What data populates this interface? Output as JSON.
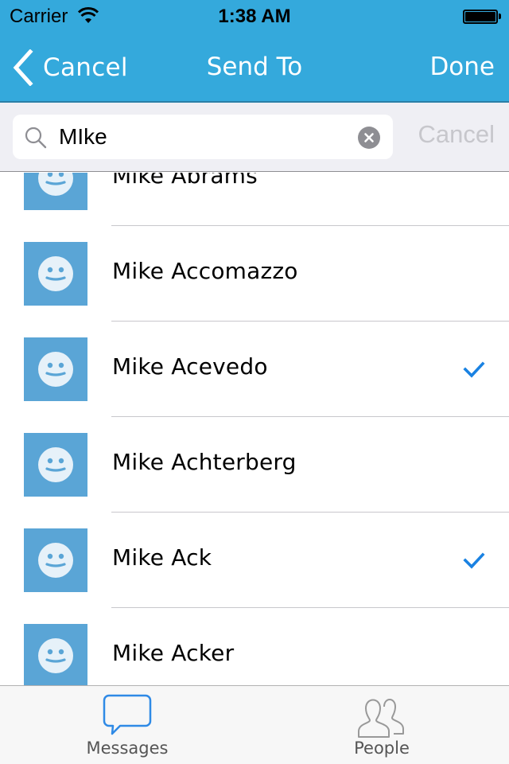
{
  "status_bar": {
    "carrier": "Carrier",
    "time": "1:38 AM",
    "battery_level": 1.0
  },
  "nav": {
    "back_label": "Cancel",
    "title": "Send To",
    "done_label": "Done"
  },
  "search": {
    "value": "MIke",
    "placeholder": "Search",
    "cancel_label": "Cancel"
  },
  "contacts": [
    {
      "name": "Mike Abrams",
      "selected": false
    },
    {
      "name": "Mike Accomazzo",
      "selected": false
    },
    {
      "name": "Mike Acevedo",
      "selected": true
    },
    {
      "name": "Mike Achterberg",
      "selected": false
    },
    {
      "name": "Mike Ack",
      "selected": true
    },
    {
      "name": "Mike Acker",
      "selected": false
    }
  ],
  "tabs": [
    {
      "label": "Messages",
      "icon": "speech-bubble-icon",
      "active": true
    },
    {
      "label": "People",
      "icon": "people-icon",
      "active": false
    }
  ],
  "colors": {
    "header": "#34a9dc",
    "accent": "#1a82e2",
    "avatar": "#5aa5d6"
  }
}
